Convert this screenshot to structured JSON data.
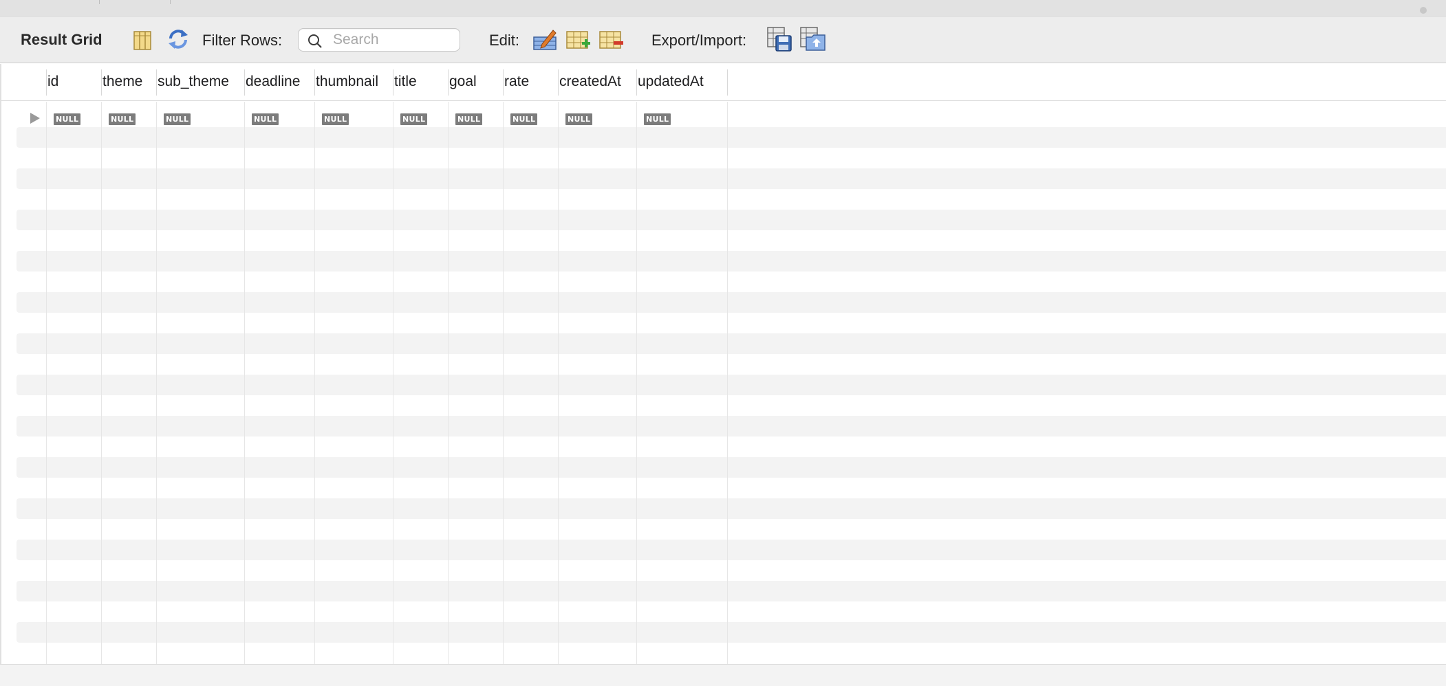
{
  "toolbar": {
    "title": "Result Grid",
    "filter_label": "Filter Rows:",
    "search_placeholder": "Search",
    "search_value": "",
    "edit_label": "Edit:",
    "export_label": "Export/Import:"
  },
  "icons": {
    "grid_layout": "column-layout-icon",
    "refresh": "refresh-icon",
    "edit_row": "edit-row-icon",
    "add_row": "add-row-icon",
    "delete_row": "delete-row-icon",
    "export": "export-save-icon",
    "import": "import-icon"
  },
  "grid": {
    "columns": [
      "id",
      "theme",
      "sub_theme",
      "deadline",
      "thumbnail",
      "title",
      "goal",
      "rate",
      "createdAt",
      "updatedAt"
    ],
    "rows": [
      [
        "NULL",
        "NULL",
        "NULL",
        "NULL",
        "NULL",
        "NULL",
        "NULL",
        "NULL",
        "NULL",
        "NULL"
      ]
    ]
  },
  "colors": {
    "toolbar_bg": "#ededed",
    "stripe": "#f3f3f3",
    "null_badge": "#7c7c7c"
  }
}
